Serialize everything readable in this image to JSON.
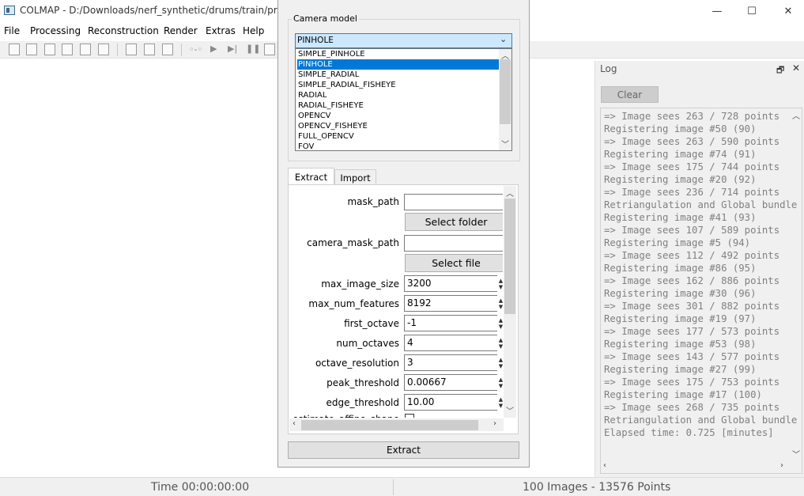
{
  "window": {
    "title": "COLMAP - D:/Downloads/nerf_synthetic/drums/train/project",
    "minimize_glyph": "—",
    "maximize_glyph": "☐",
    "close_glyph": "✕"
  },
  "menu": {
    "file": "File",
    "processing": "Processing",
    "reconstruction": "Reconstruction",
    "render": "Render",
    "extras": "Extras",
    "help": "Help"
  },
  "log": {
    "title": "Log",
    "float_glyph": "🗗",
    "close_glyph": "✕",
    "clear_label": "Clear",
    "lines": [
      "=> Image sees 263 / 728 points",
      "Registering image #50 (90)",
      "=> Image sees 263 / 590 points",
      "Registering image #74 (91)",
      "=> Image sees 175 / 744 points",
      "Registering image #20 (92)",
      "=> Image sees 236 / 714 points",
      "Retriangulation and Global bundle",
      "Registering image #41 (93)",
      "=> Image sees 107 / 589 points",
      "Registering image #5 (94)",
      "=> Image sees 112 / 492 points",
      "Registering image #86 (95)",
      "=> Image sees 162 / 886 points",
      "Registering image #30 (96)",
      "=> Image sees 301 / 882 points",
      "Registering image #19 (97)",
      "=> Image sees 177 / 573 points",
      "Registering image #53 (98)",
      "=> Image sees 143 / 577 points",
      "Registering image #27 (99)",
      "=> Image sees 175 / 753 points",
      "Registering image #17 (100)",
      "=> Image sees 268 / 735 points",
      "Retriangulation and Global bundle",
      "Elapsed time: 0.725 [minutes]"
    ]
  },
  "status": {
    "time": "Time 00:00:00:00",
    "counts": "100 Images - 13576 Points"
  },
  "dialog": {
    "camera_group_label": "Camera model",
    "camera_selected": "PINHOLE",
    "camera_options": [
      "SIMPLE_PINHOLE",
      "PINHOLE",
      "SIMPLE_RADIAL",
      "SIMPLE_RADIAL_FISHEYE",
      "RADIAL",
      "RADIAL_FISHEYE",
      "OPENCV",
      "OPENCV_FISHEYE",
      "FULL_OPENCV",
      "FOV"
    ],
    "highlighted_index": 1,
    "tabs": {
      "extract": "Extract",
      "import": "Import"
    },
    "fields": {
      "mask_path": {
        "label": "mask_path",
        "value": ""
      },
      "select_folder": "Select folder",
      "camera_mask_path": {
        "label": "camera_mask_path",
        "value": ""
      },
      "select_file": "Select file",
      "max_image_size": {
        "label": "max_image_size",
        "value": "3200"
      },
      "max_num_features": {
        "label": "max_num_features",
        "value": "8192"
      },
      "first_octave": {
        "label": "first_octave",
        "value": "-1"
      },
      "num_octaves": {
        "label": "num_octaves",
        "value": "4"
      },
      "octave_resolution": {
        "label": "octave_resolution",
        "value": "3"
      },
      "peak_threshold": {
        "label": "peak_threshold",
        "value": "0.00667"
      },
      "edge_threshold": {
        "label": "edge_threshold",
        "value": "10.00"
      },
      "estimate_affine_shape": {
        "label": "estimate_affine_shape"
      }
    },
    "extract_button": "Extract"
  }
}
